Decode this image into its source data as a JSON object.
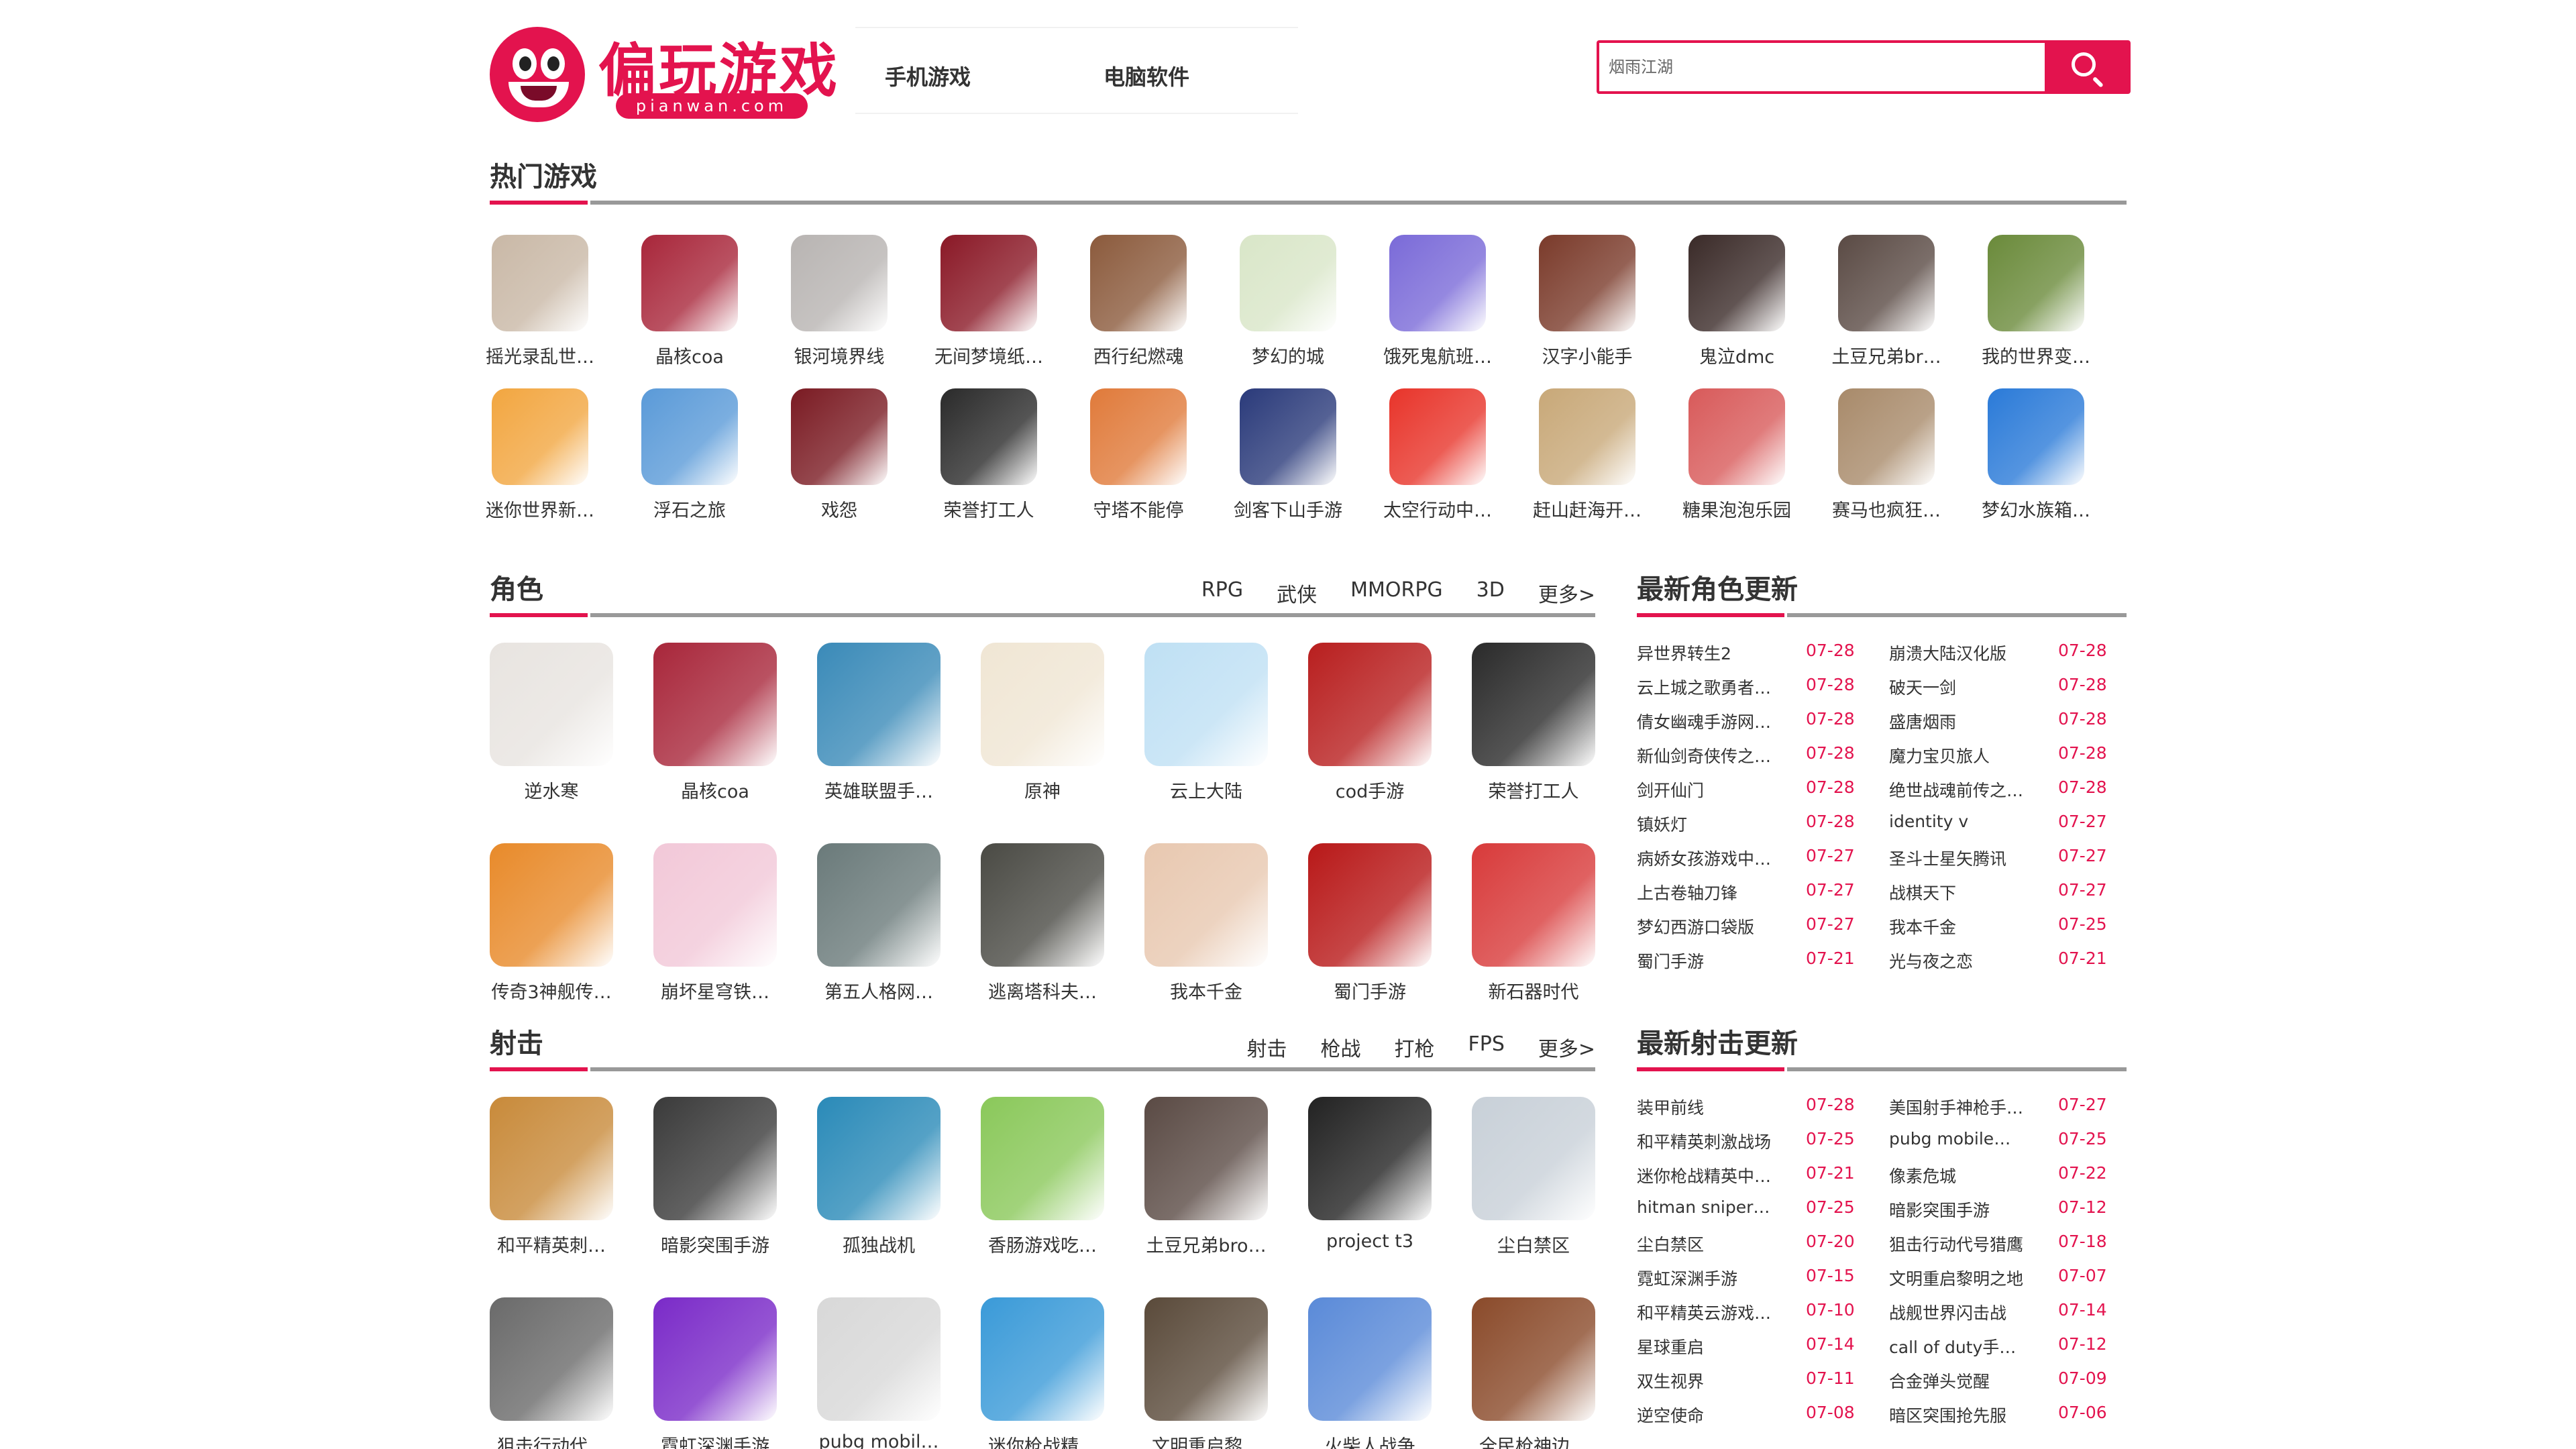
{
  "header": {
    "logo_text": "偏玩游戏",
    "logo_sub": "pianwan.com",
    "nav": [
      "手机游戏",
      "电脑软件"
    ],
    "search_placeholder": "烟雨江湖"
  },
  "hot": {
    "title": "热门游戏",
    "items": [
      {
        "label": "摇光录乱世…",
        "color": "#c9b8a6"
      },
      {
        "label": "晶核coa",
        "color": "#a8263a"
      },
      {
        "label": "银河境界线",
        "color": "#b8b4b2"
      },
      {
        "label": "无间梦境纸…",
        "color": "#8a1826"
      },
      {
        "label": "西行纪燃魂",
        "color": "#8b5a3c"
      },
      {
        "label": "梦幻的城",
        "color": "#d9e6c8"
      },
      {
        "label": "饿死鬼航班…",
        "color": "#7a6ad8"
      },
      {
        "label": "汉字小能手",
        "color": "#7a3a2a"
      },
      {
        "label": "鬼泣dmc",
        "color": "#3a2a28"
      },
      {
        "label": "土豆兄弟br…",
        "color": "#5a4a44"
      },
      {
        "label": "我的世界变…",
        "color": "#6a8a3a"
      },
      {
        "label": "迷你世界新…",
        "color": "#f2a640"
      },
      {
        "label": "浮石之旅",
        "color": "#5a9ad8"
      },
      {
        "label": "戏怨",
        "color": "#7a1a22"
      },
      {
        "label": "荣誉打工人",
        "color": "#2a2a2a"
      },
      {
        "label": "守塔不能停",
        "color": "#e07a3a"
      },
      {
        "label": "剑客下山手游",
        "color": "#2a3a7a"
      },
      {
        "label": "太空行动中…",
        "color": "#e8342a"
      },
      {
        "label": "赶山赶海开…",
        "color": "#c8a878"
      },
      {
        "label": "糖果泡泡乐园",
        "color": "#d85a5a"
      },
      {
        "label": "赛马也疯狂…",
        "color": "#a88a6a"
      },
      {
        "label": "梦幻水族箱…",
        "color": "#2a7ad8"
      }
    ]
  },
  "role": {
    "title": "角色",
    "tags": [
      "RPG",
      "武侠",
      "MMORPG",
      "3D",
      "更多>"
    ],
    "items": [
      {
        "label": "逆水寒",
        "color": "#e8e4e0"
      },
      {
        "label": "晶核coa",
        "color": "#a8263a"
      },
      {
        "label": "英雄联盟手…",
        "color": "#3a8ab8"
      },
      {
        "label": "原神",
        "color": "#f0e6d4"
      },
      {
        "label": "云上大陆",
        "color": "#bfe0f4"
      },
      {
        "label": "cod手游",
        "color": "#b81e1e"
      },
      {
        "label": "荣誉打工人",
        "color": "#2a2a2a"
      },
      {
        "label": "传奇3神舰传…",
        "color": "#e88a2a"
      },
      {
        "label": "崩坏星穹铁…",
        "color": "#f2c8d8"
      },
      {
        "label": "第五人格网…",
        "color": "#6a7a7a"
      },
      {
        "label": "逃离塔科夫…",
        "color": "#4a4a44"
      },
      {
        "label": "我本千金",
        "color": "#e8c8b0"
      },
      {
        "label": "蜀门手游",
        "color": "#b81818"
      },
      {
        "label": "新石器时代",
        "color": "#d83a3a"
      }
    ]
  },
  "role_latest": {
    "title": "最新角色更新",
    "rows": [
      {
        "name": "异世界转生2",
        "date": "07-28"
      },
      {
        "name": "崩溃大陆汉化版",
        "date": "07-28"
      },
      {
        "name": "云上城之歌勇者…",
        "date": "07-28"
      },
      {
        "name": "破天一剑",
        "date": "07-28"
      },
      {
        "name": "倩女幽魂手游网…",
        "date": "07-28"
      },
      {
        "name": "盛唐烟雨",
        "date": "07-28"
      },
      {
        "name": "新仙剑奇侠传之…",
        "date": "07-28"
      },
      {
        "name": "魔力宝贝旅人",
        "date": "07-28"
      },
      {
        "name": "剑开仙门",
        "date": "07-28"
      },
      {
        "name": "绝世战魂前传之…",
        "date": "07-28"
      },
      {
        "name": "镇妖灯",
        "date": "07-28"
      },
      {
        "name": "identity v",
        "date": "07-27"
      },
      {
        "name": "病娇女孩游戏中…",
        "date": "07-27"
      },
      {
        "name": "圣斗士星矢腾讯",
        "date": "07-27"
      },
      {
        "name": "上古卷轴刀锋",
        "date": "07-27"
      },
      {
        "name": "战棋天下",
        "date": "07-27"
      },
      {
        "name": "梦幻西游口袋版",
        "date": "07-27"
      },
      {
        "name": "我本千金",
        "date": "07-25"
      },
      {
        "name": "蜀门手游",
        "date": "07-21"
      },
      {
        "name": "光与夜之恋",
        "date": "07-21"
      }
    ]
  },
  "shoot": {
    "title": "射击",
    "tags": [
      "射击",
      "枪战",
      "打枪",
      "FPS",
      "更多>"
    ],
    "items": [
      {
        "label": "和平精英刺…",
        "color": "#c88a3a"
      },
      {
        "label": "暗影突围手游",
        "color": "#3a3a3a"
      },
      {
        "label": "孤独战机",
        "color": "#2a8ab8"
      },
      {
        "label": "香肠游戏吃…",
        "color": "#8ac85a"
      },
      {
        "label": "土豆兄弟bro…",
        "color": "#5a4a44"
      },
      {
        "label": "project t3",
        "color": "#222222"
      },
      {
        "label": "尘白禁区",
        "color": "#c8d0d8"
      },
      {
        "label": "狙击行动代…",
        "color": "#6a6a6a"
      },
      {
        "label": "霓虹深渊手游",
        "color": "#7a2ac8"
      },
      {
        "label": "pubg mobil…",
        "color": "#d8d8d8"
      },
      {
        "label": "迷你枪战精…",
        "color": "#3a9ad8"
      },
      {
        "label": "文明重启黎…",
        "color": "#5a4a3a"
      },
      {
        "label": "火柴人战争",
        "color": "#5a8ad8"
      },
      {
        "label": "全民枪神边…",
        "color": "#8a4a2a"
      }
    ]
  },
  "shoot_latest": {
    "title": "最新射击更新",
    "rows": [
      {
        "name": "装甲前线",
        "date": "07-28"
      },
      {
        "name": "美国射手神枪手…",
        "date": "07-27"
      },
      {
        "name": "和平精英刺激战场",
        "date": "07-25"
      },
      {
        "name": "pubg mobile…",
        "date": "07-25"
      },
      {
        "name": "迷你枪战精英中…",
        "date": "07-21"
      },
      {
        "name": "像素危城",
        "date": "07-22"
      },
      {
        "name": "hitman sniper…",
        "date": "07-25"
      },
      {
        "name": "暗影突围手游",
        "date": "07-12"
      },
      {
        "name": "尘白禁区",
        "date": "07-20"
      },
      {
        "name": "狙击行动代号猎鹰",
        "date": "07-18"
      },
      {
        "name": "霓虹深渊手游",
        "date": "07-15"
      },
      {
        "name": "文明重启黎明之地",
        "date": "07-07"
      },
      {
        "name": "和平精英云游戏…",
        "date": "07-10"
      },
      {
        "name": "战舰世界闪击战",
        "date": "07-14"
      },
      {
        "name": "星球重启",
        "date": "07-14"
      },
      {
        "name": "call of duty手…",
        "date": "07-12"
      },
      {
        "name": "双生视界",
        "date": "07-11"
      },
      {
        "name": "合金弹头觉醒",
        "date": "07-09"
      },
      {
        "name": "逆空使命",
        "date": "07-08"
      },
      {
        "name": "暗区突围抢先服",
        "date": "07-06"
      }
    ]
  }
}
